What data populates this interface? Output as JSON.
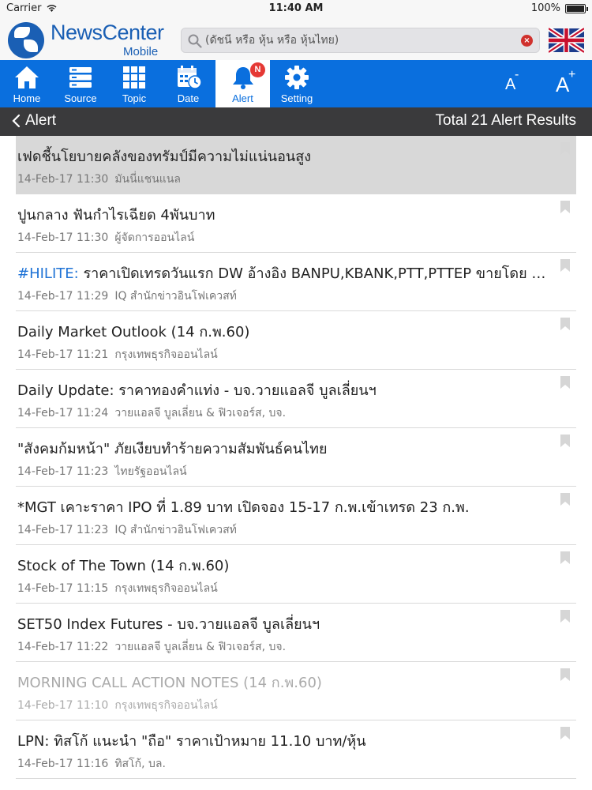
{
  "status_bar": {
    "carrier": "Carrier",
    "time": "11:40 AM",
    "battery": "100%"
  },
  "header": {
    "logo_title": "NewsCenter",
    "logo_subtitle": "Mobile",
    "search_placeholder": "(ดัชนี หรือ หุ้น หรือ หุ้นไทย)"
  },
  "toolbar": {
    "home": "Home",
    "source": "Source",
    "topic": "Topic",
    "date": "Date",
    "alert": "Alert",
    "alert_badge": "N",
    "setting": "Setting",
    "font_decrease": "A",
    "font_decrease_sign": "-",
    "font_increase": "A",
    "font_increase_sign": "+"
  },
  "subheader": {
    "back_label": "Alert",
    "results": "Total 21 Alert Results"
  },
  "items": [
    {
      "tag": "",
      "title": "เฟดชี้นโยบายคลังของทรัมป์มีความไม่แน่นอนสูง",
      "date": "14-Feb-17 11:30",
      "source": "มันนี่แชนแนล"
    },
    {
      "tag": "",
      "title": "ปูนกลาง ฟันกำไรเฉียด 4พันบาท",
      "date": "14-Feb-17 11:30",
      "source": "ผู้จัดการออนไลน์"
    },
    {
      "tag": "#HILITE:",
      "title": "ราคาเปิดเทรดวันแรก DW อ้างอิง BANPU,KBANK,PTT,PTTEP ขายโดย บล.ภัทร",
      "date": "14-Feb-17 11:29",
      "source": "IQ สำนักข่าวอินโฟเควสท์"
    },
    {
      "tag": "",
      "title": "Daily Market Outlook (14 ก.พ.60)",
      "date": "14-Feb-17 11:21",
      "source": "กรุงเทพธุรกิจออนไลน์"
    },
    {
      "tag": "",
      "title": "Daily Update: ราคาทองคำแท่ง - บจ.วายแอลจี บูลเลี่ยนฯ",
      "date": "14-Feb-17 11:24",
      "source": "วายแอลจี บูลเลี่ยน & ฟิวเจอร์ส, บจ."
    },
    {
      "tag": "",
      "title": "\"สังคมก้มหน้า\" ภัยเงียบทำร้ายความสัมพันธ์คนไทย",
      "date": "14-Feb-17 11:23",
      "source": "ไทยรัฐออนไลน์"
    },
    {
      "tag": "",
      "title": "*MGT เคาะราคา IPO ที่ 1.89 บาท เปิดจอง 15-17 ก.พ.เข้าเทรด 23 ก.พ.",
      "date": "14-Feb-17 11:23",
      "source": "IQ สำนักข่าวอินโฟเควสท์"
    },
    {
      "tag": "",
      "title": "Stock of The Town (14 ก.พ.60)",
      "date": "14-Feb-17 11:15",
      "source": "กรุงเทพธุรกิจออนไลน์"
    },
    {
      "tag": "",
      "title": "SET50 Index Futures - บจ.วายแอลจี บูลเลี่ยนฯ",
      "date": "14-Feb-17 11:22",
      "source": "วายแอลจี บูลเลี่ยน & ฟิวเจอร์ส, บจ."
    },
    {
      "tag": "",
      "title": "MORNING CALL ACTION NOTES (14 ก.พ.60)",
      "date": "14-Feb-17 11:10",
      "source": "กรุงเทพธุรกิจออนไลน์"
    },
    {
      "tag": "",
      "title": "LPN: ทิสโก้ แนะนำ \"ถือ\" ราคาเป้าหมาย 11.10 บาท/หุ้น",
      "date": "14-Feb-17 11:16",
      "source": "ทิสโก้, บล."
    }
  ],
  "colors": {
    "toolbar": "#0a6fde",
    "tag": "#1f73d6",
    "subheader": "#3a3a3c"
  }
}
